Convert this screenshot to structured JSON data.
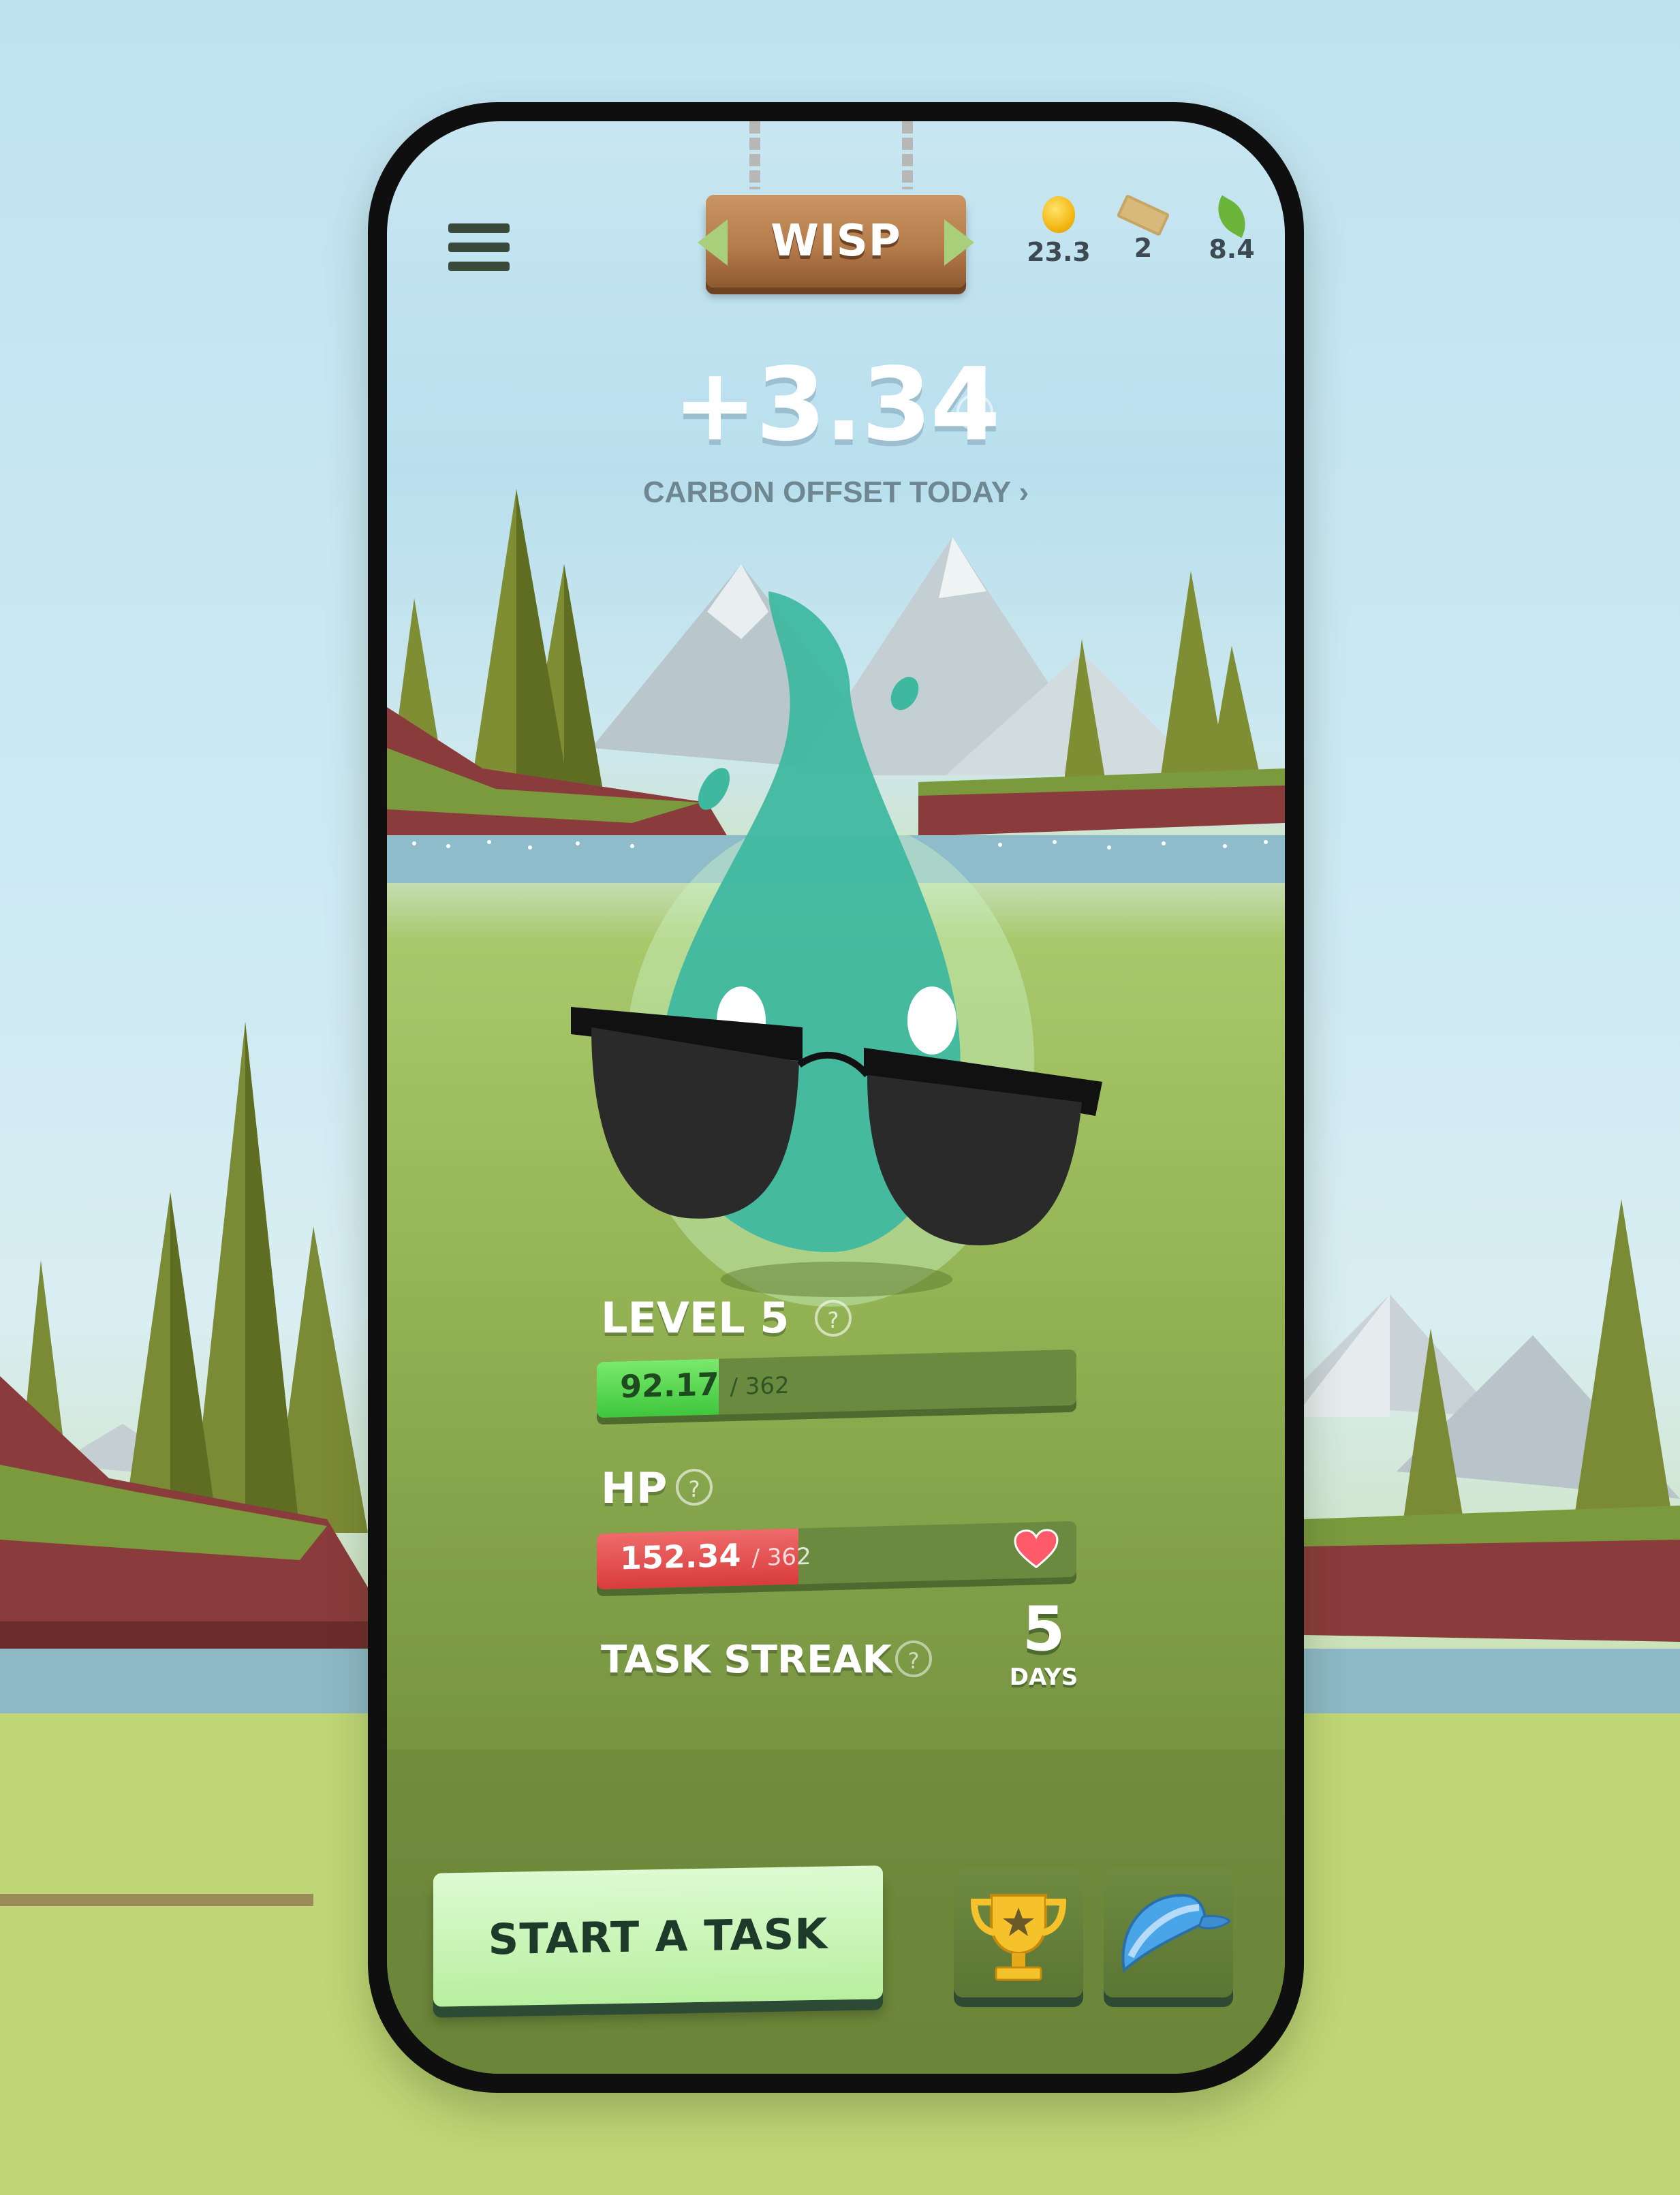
{
  "app": {
    "pet_name": "WISP"
  },
  "currencies": [
    {
      "icon": "coin-icon",
      "value": "23.3"
    },
    {
      "icon": "ticket-icon",
      "value": "2"
    },
    {
      "icon": "leaf-icon",
      "value": "8.4"
    }
  ],
  "offset": {
    "value": "+3.34",
    "label": "CARBON OFFSET TODAY",
    "chevron": "›"
  },
  "level": {
    "label": "LEVEL 5",
    "value": "92.17",
    "max": "/ 362",
    "progress": 0.2546
  },
  "hp": {
    "label": "HP",
    "value": "152.34",
    "max": "/ 362",
    "progress": 0.4208
  },
  "streak": {
    "label": "TASK STREAK",
    "count": "5",
    "unit": "DAYS"
  },
  "actions": {
    "start_label": "START A TASK",
    "trophy_icon": "trophy-icon",
    "cap_icon": "cap-icon"
  },
  "help_glyph": "?",
  "colors": {
    "level_bar": "#4fd646",
    "hp_bar": "#e04646",
    "start_button": "#c8f5b3",
    "pet": "#3fb8a0"
  }
}
